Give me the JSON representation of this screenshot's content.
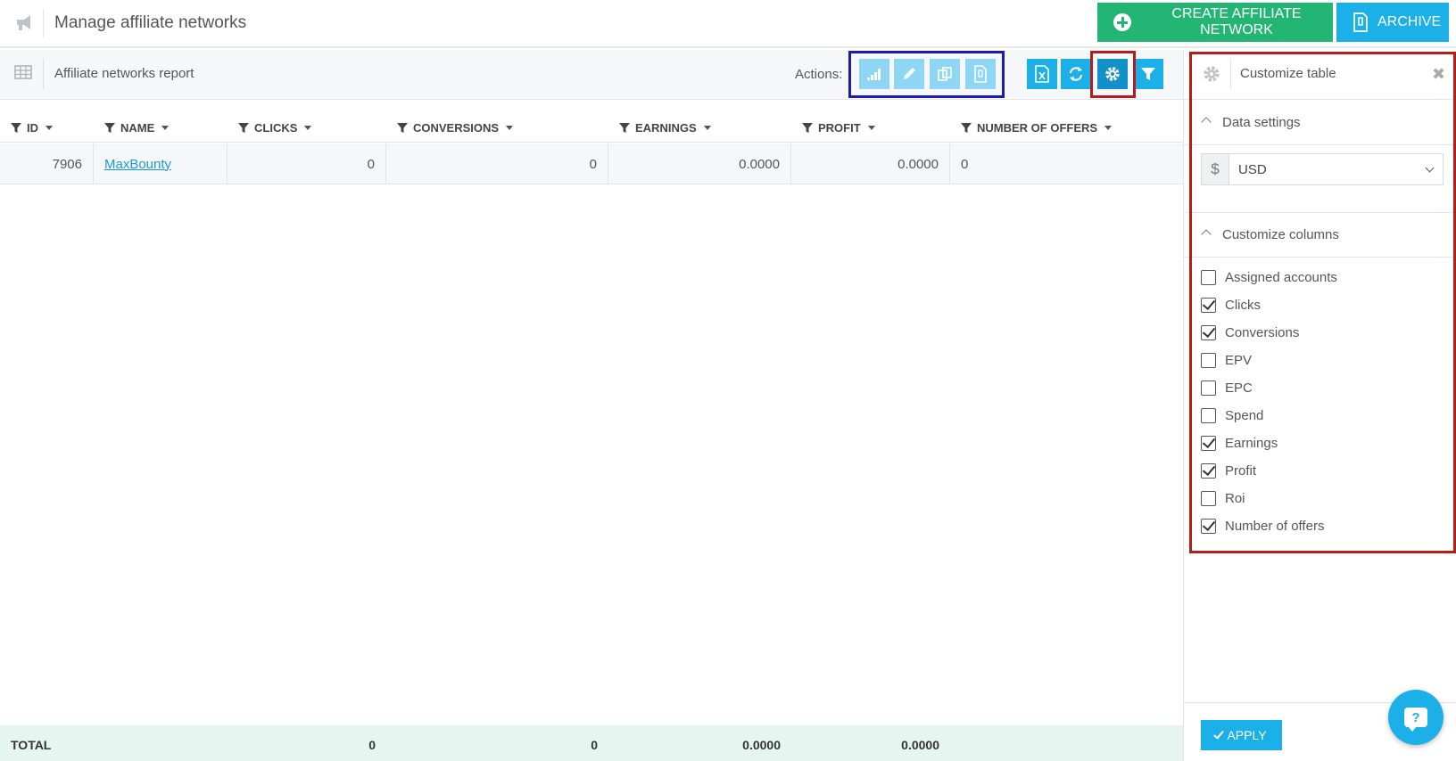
{
  "header": {
    "title": "Manage affiliate networks",
    "create_label": "CREATE AFFILIATE NETWORK",
    "archive_label": "ARCHIVE"
  },
  "toolbar": {
    "title": "Affiliate networks report",
    "actions_label": "Actions:",
    "action_icons": [
      "bar-chart-icon",
      "pencil-icon",
      "copy-icon",
      "archive-file-icon"
    ],
    "tool_icons": [
      "excel-export-icon",
      "refresh-icon",
      "gear-icon",
      "filter-icon"
    ]
  },
  "table": {
    "columns": [
      "ID",
      "NAME",
      "CLICKS",
      "CONVERSIONS",
      "EARNINGS",
      "PROFIT",
      "NUMBER OF OFFERS"
    ],
    "rows": [
      {
        "id": "7906",
        "name": "MaxBounty",
        "clicks": "0",
        "conversions": "0",
        "earnings": "0.0000",
        "profit": "0.0000",
        "offers": "0"
      }
    ],
    "total": {
      "label": "TOTAL",
      "clicks": "0",
      "conversions": "0",
      "earnings": "0.0000",
      "profit": "0.0000"
    }
  },
  "panel": {
    "title": "Customize table",
    "data_settings_label": "Data settings",
    "currency_symbol": "$",
    "currency": "USD",
    "customize_columns_label": "Customize columns",
    "columns": [
      {
        "label": "Assigned accounts",
        "checked": false
      },
      {
        "label": "Clicks",
        "checked": true
      },
      {
        "label": "Conversions",
        "checked": true
      },
      {
        "label": "EPV",
        "checked": false
      },
      {
        "label": "EPC",
        "checked": false
      },
      {
        "label": "Spend",
        "checked": false
      },
      {
        "label": "Earnings",
        "checked": true
      },
      {
        "label": "Profit",
        "checked": true
      },
      {
        "label": "Roi",
        "checked": false
      },
      {
        "label": "Number of offers",
        "checked": true
      }
    ],
    "apply_label": "APPLY"
  },
  "colors": {
    "create_green": "#22b573",
    "primary_blue": "#1cb0e8",
    "highlight_blue": "#1c1ca8",
    "highlight_red": "#b51c1c",
    "total_bg": "#e4f6ef"
  }
}
